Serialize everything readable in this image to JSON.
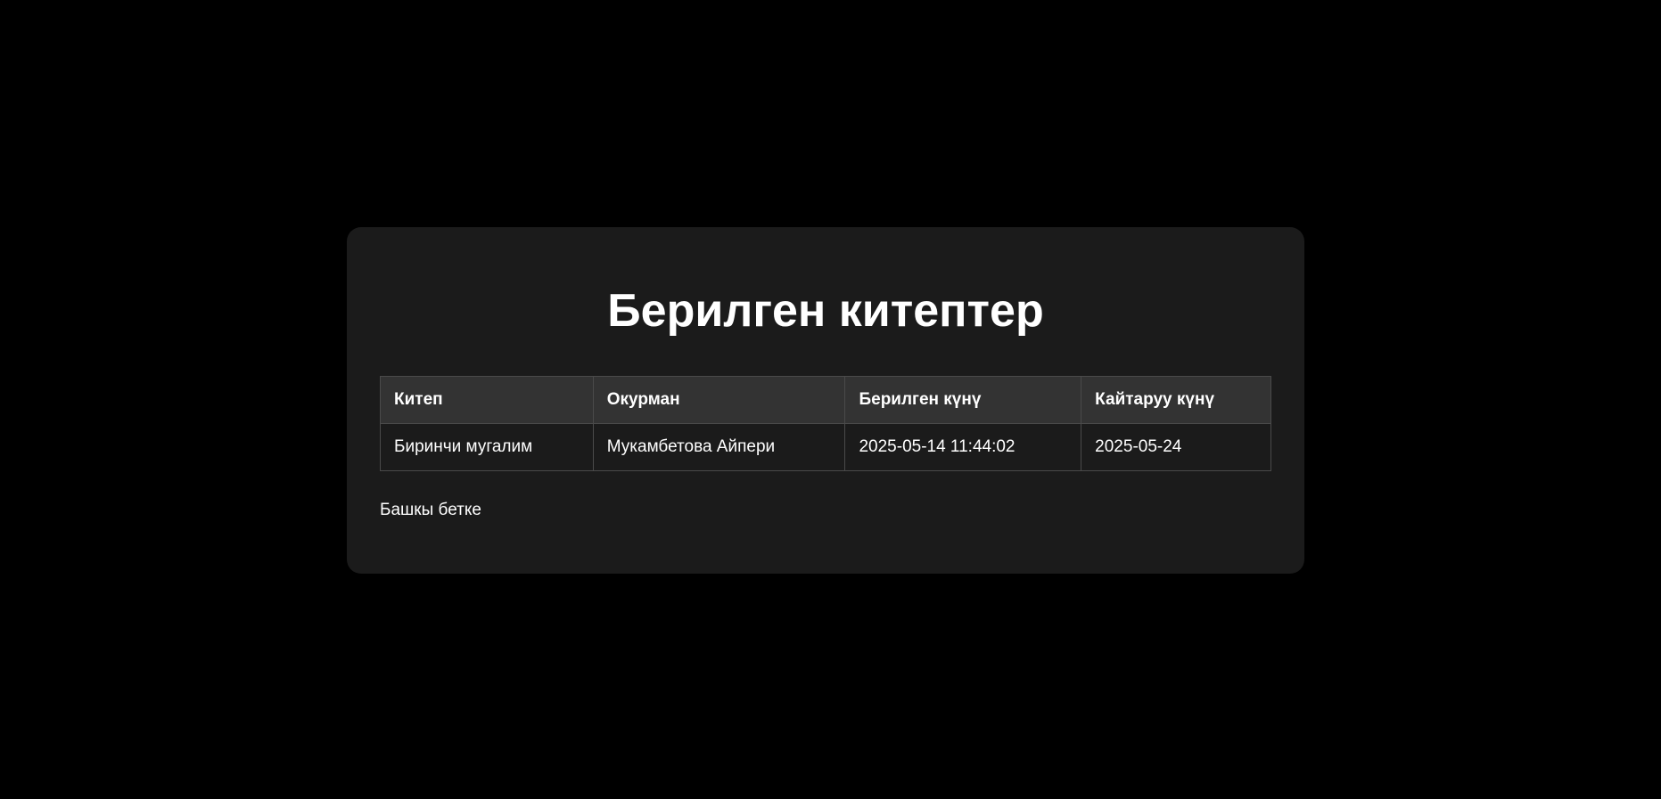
{
  "page": {
    "title": "Берилген китептер",
    "back_link": "Башкы бетке"
  },
  "table": {
    "headers": [
      "Китеп",
      "Окурман",
      "Берилген күнү",
      "Кайтаруу күнү"
    ],
    "rows": [
      [
        "Биринчи мугалим",
        "Мукамбетова Айпери",
        "2025-05-14 11:44:02",
        "2025-05-24"
      ]
    ]
  },
  "colors": {
    "background": "#000000",
    "card": "#1b1b1b",
    "header_row": "#333333",
    "border": "#4a4a4a",
    "text": "#ffffff"
  }
}
